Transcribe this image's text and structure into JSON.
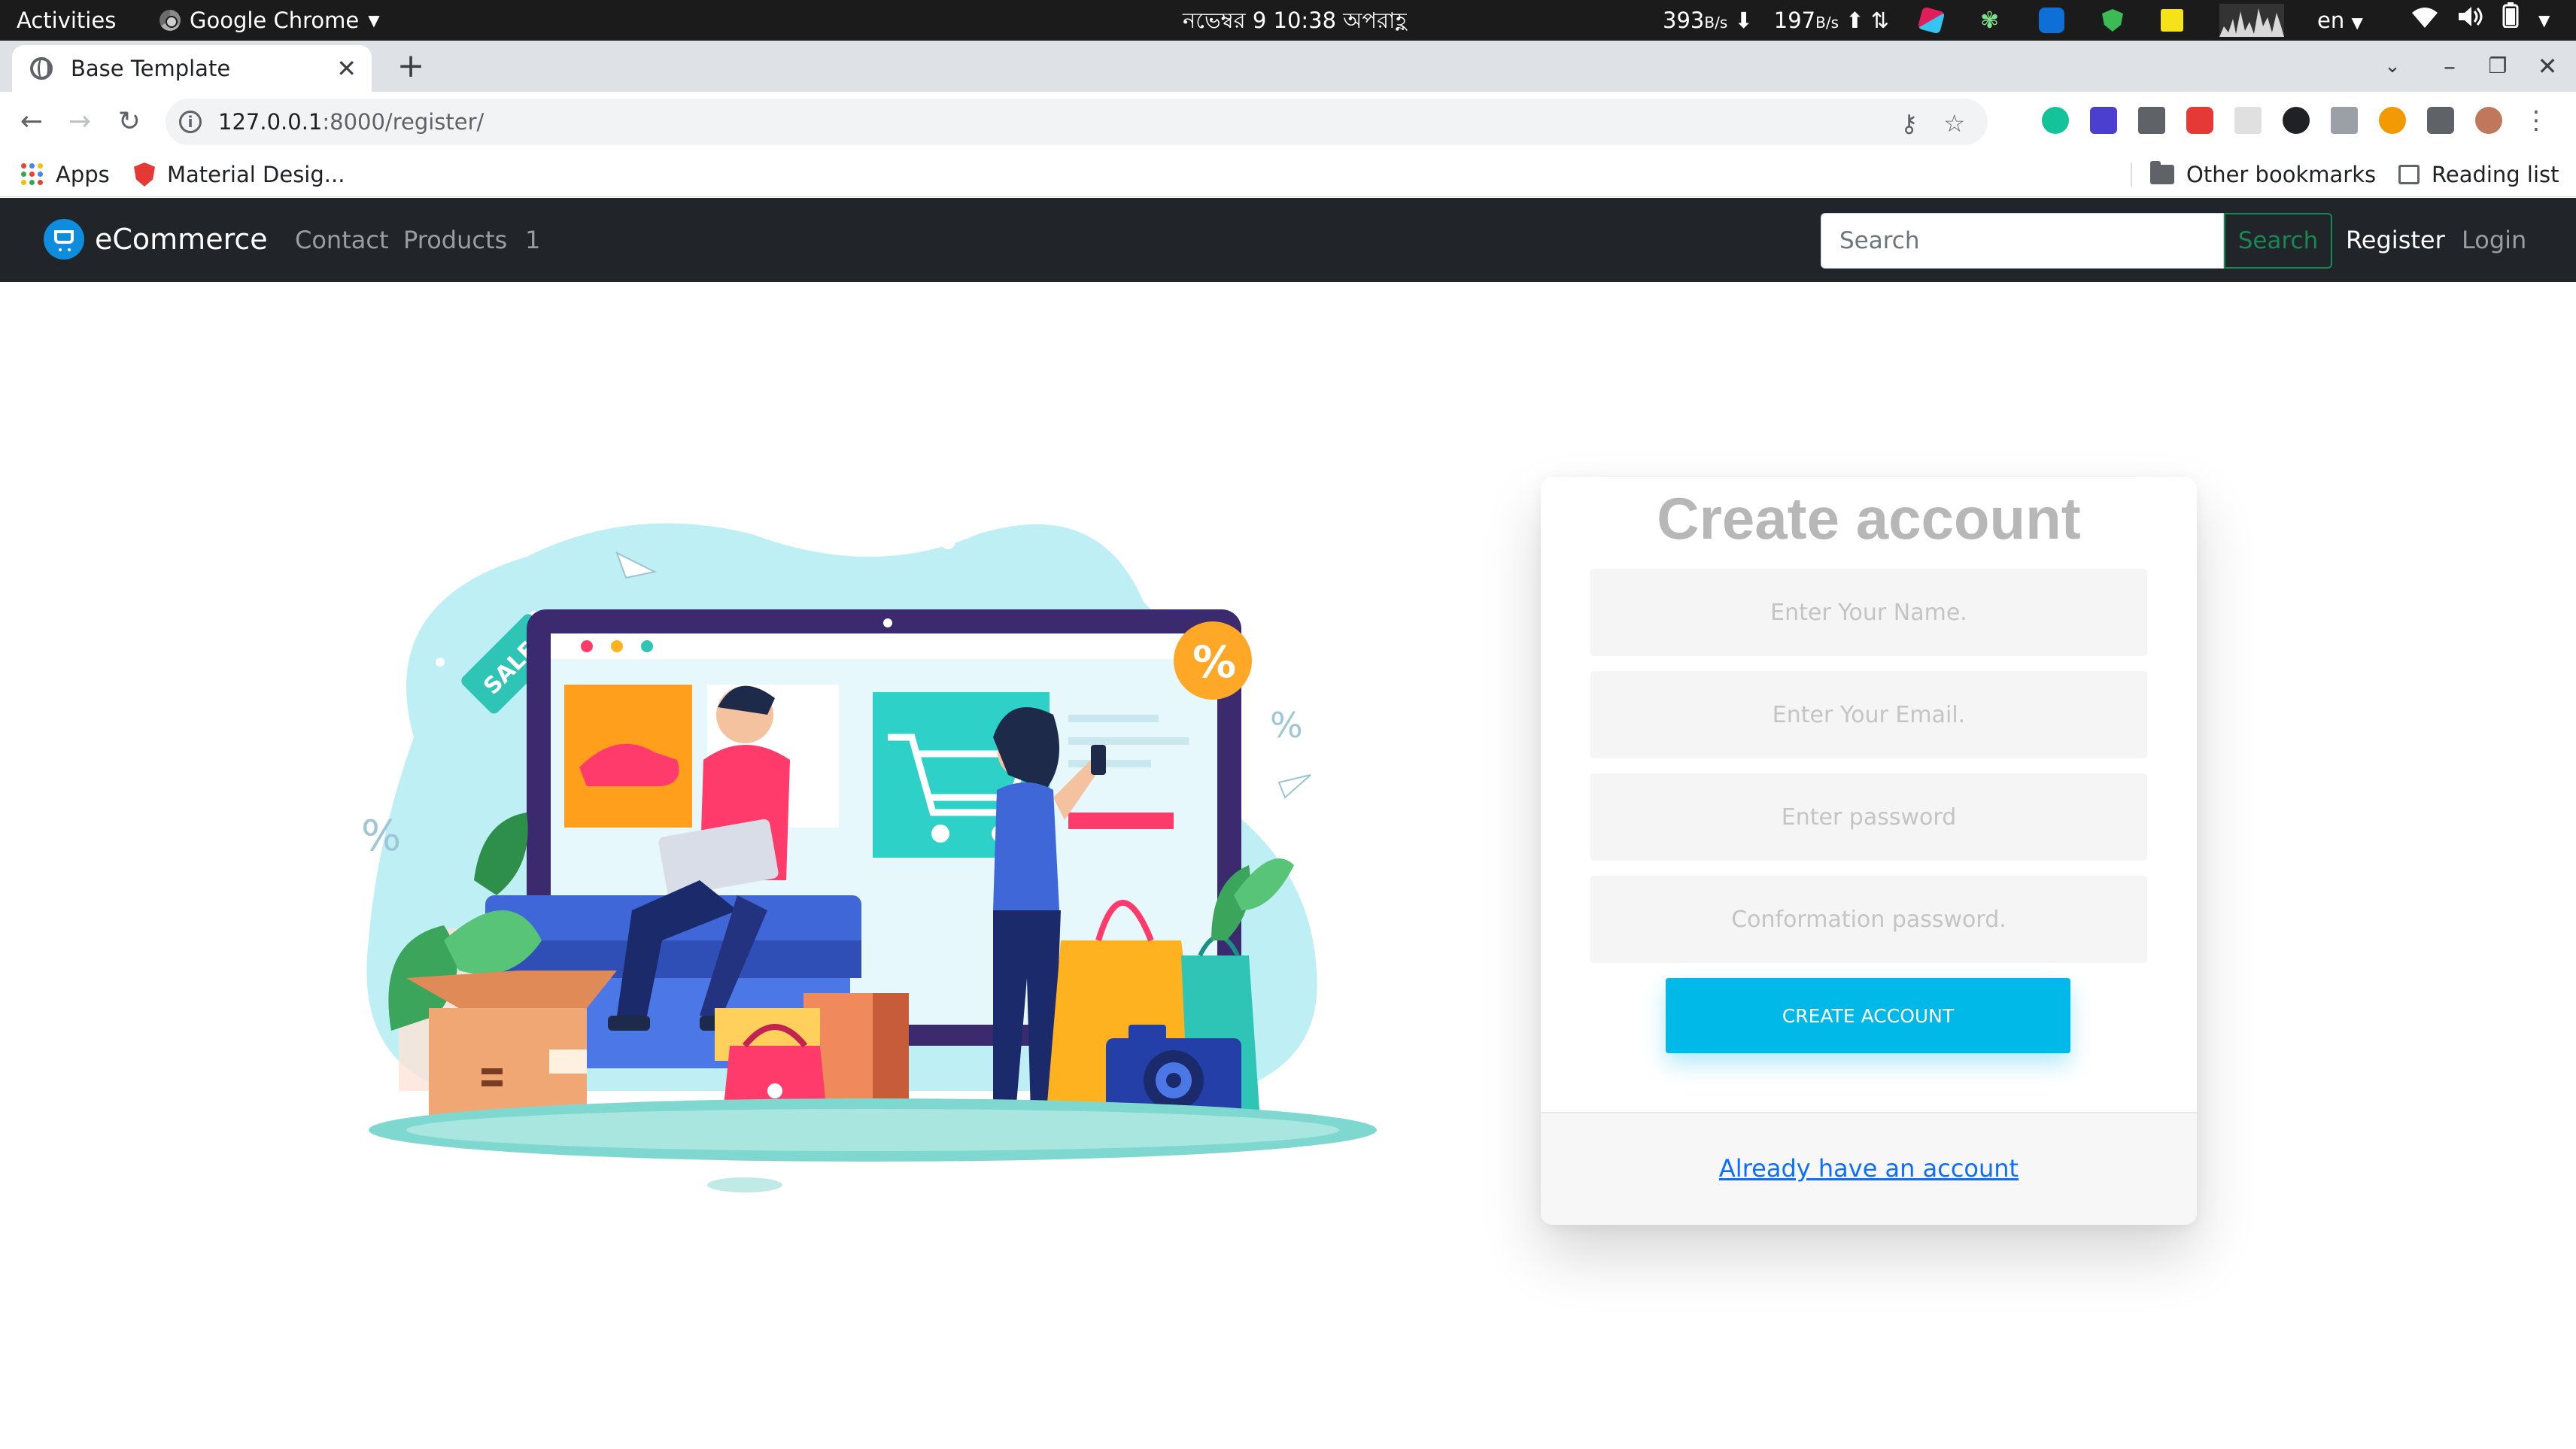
{
  "os_bar": {
    "activities": "Activities",
    "app_name": "Google Chrome",
    "clock": "নভেম্বর 9  10:38 অপরাহ্ণ",
    "net_down_value": "393",
    "net_down_unit": "B/s",
    "net_up_value": "197",
    "net_up_unit": "B/s",
    "language": "en"
  },
  "browser": {
    "tab_title": "Base Template",
    "url_host": "127.0.0.1",
    "url_path": ":8000/register/",
    "bookmarks": [
      {
        "label": "Apps"
      },
      {
        "label": "Material Desig..."
      }
    ],
    "other_bookmarks": "Other bookmarks",
    "reading_list": "Reading list"
  },
  "site_nav": {
    "brand": "eCommerce",
    "links": [
      "Contact",
      "Products",
      "1"
    ],
    "search_placeholder": "Search",
    "search_button": "Search",
    "register": "Register",
    "login": "Login"
  },
  "illustration": {
    "sale_tag": "SALE",
    "percent_badge": "%"
  },
  "register_card": {
    "title": "Create account",
    "name_placeholder": "Enter Your Name.",
    "email_placeholder": "Enter Your Email.",
    "password_placeholder": "Enter password",
    "confirm_placeholder": "Conformation password.",
    "submit_label": "CREATE ACCOUNT",
    "login_link": "Already have an account"
  },
  "colors": {
    "navbar_bg": "#212529",
    "brand_icon": "#0d8ddb",
    "search_button": "#198754",
    "create_button": "#00b9e8",
    "link": "#0d6efd"
  }
}
